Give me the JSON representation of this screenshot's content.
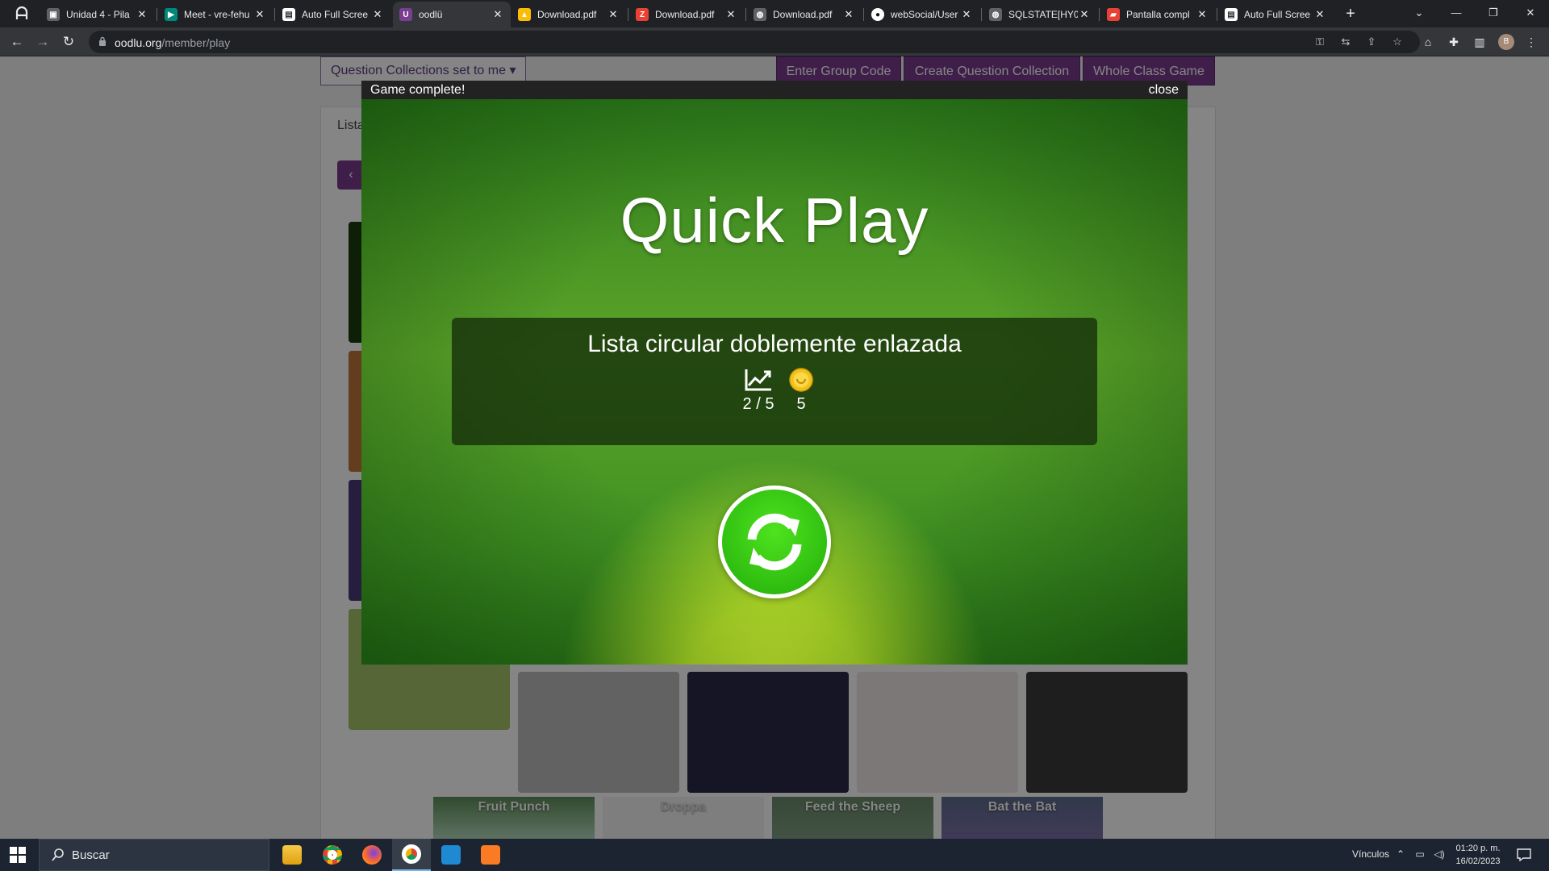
{
  "browser": {
    "tabs": [
      {
        "title": "Unidad 4 - Pila",
        "icon": "classroom-icon",
        "color": "#5f6368"
      },
      {
        "title": "Meet - vre-fehu",
        "icon": "meet-icon",
        "color": "#00897b"
      },
      {
        "title": "Auto Full Scree",
        "icon": "doc-icon",
        "color": "#ffffff"
      },
      {
        "title": "oodlü",
        "icon": "oodlu-icon",
        "color": "#7a3d8f"
      },
      {
        "title": "Download.pdf",
        "icon": "drive-icon",
        "color": "#fbbc04"
      },
      {
        "title": "Download.pdf",
        "icon": "pdf-icon",
        "color": "#e94235"
      },
      {
        "title": "Download.pdf",
        "icon": "globe-icon",
        "color": "#9aa0a6"
      },
      {
        "title": "webSocial/User",
        "icon": "github-icon",
        "color": "#ffffff"
      },
      {
        "title": "SQLSTATE[HY0",
        "icon": "globe-icon",
        "color": "#9aa0a6"
      },
      {
        "title": "Pantalla compl",
        "icon": "flag-icon",
        "color": "#e94235"
      },
      {
        "title": "Auto Full Scree",
        "icon": "doc-icon",
        "color": "#ffffff"
      }
    ],
    "url_domain": "oodlu.org",
    "url_path": "/member/play"
  },
  "page": {
    "collections_select": "Question Collections set to me",
    "buttons": {
      "enter_group_code": "Enter Group Code",
      "create_collection": "Create Question Collection",
      "whole_class_game": "Whole Class Game"
    },
    "lista_label": "Lista",
    "game_cards": [
      {
        "label": "Fruit Punch"
      },
      {
        "label": "Droppa"
      },
      {
        "label": "Feed the Sheep"
      },
      {
        "label": "Bat the Bat"
      }
    ]
  },
  "modal": {
    "title": "Game complete!",
    "close": "close",
    "heading": "Quick Play",
    "collection_name": "Lista circular doblemente enlazada",
    "score": "2 / 5",
    "coins": "5",
    "score_icon": "chart-up-icon",
    "coin_icon": "coin-icon",
    "replay_icon": "refresh-icon"
  },
  "taskbar": {
    "search_placeholder": "Buscar",
    "vinculos": "Vínculos",
    "time": "01:20 p. m.",
    "date": "16/02/2023"
  },
  "colors": {
    "brand_purple": "#7a3d8f",
    "modal_green": "#3f8f22",
    "replay_green": "#2fbe10"
  }
}
